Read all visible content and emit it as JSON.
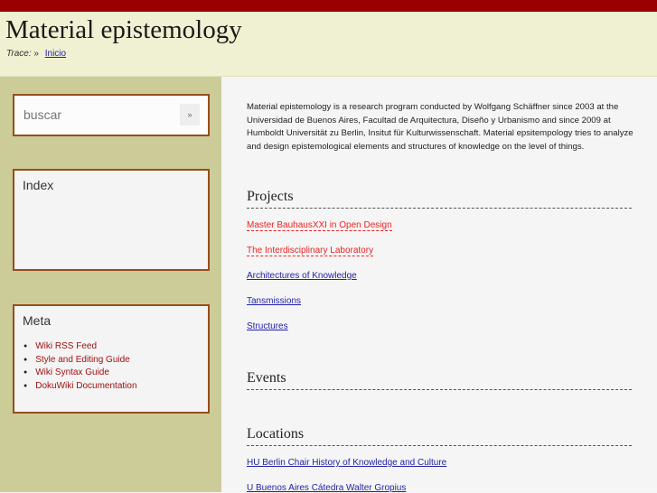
{
  "header": {
    "title": "Material epistemology",
    "trace_label": "Trace:",
    "trace_sep": "»",
    "breadcrumb": "Inicio"
  },
  "sidebar": {
    "search": {
      "placeholder": "buscar",
      "button": "»"
    },
    "index": {
      "title": "Index"
    },
    "meta": {
      "title": "Meta",
      "items": [
        "Wiki RSS Feed",
        "Style and Editing Guide",
        "Wiki Syntax Guide",
        "DokuWiki Documentation"
      ]
    }
  },
  "main": {
    "intro": "Material epistemology is a research program conducted by Wolfgang Schäffner since 2003 at the Universidad de Buenos Aires, Facultad de Arquitectura, Diseño y Urbanismo and since 2009 at Humboldt Universität zu Berlin, Insitut für Kulturwissenschaft. Material epsitempology tries to analyze and design epistemological elements and structures of knowledge on the level of things.",
    "projects": {
      "title": "Projects",
      "links": [
        "Master BauhausXXI in Open Design",
        "The Interdisciplinary Laboratory",
        "Architectures of Knowledge",
        "Tansmissions",
        "Structures"
      ]
    },
    "events": {
      "title": "Events"
    },
    "locations": {
      "title": "Locations",
      "links": [
        "HU Berlin Chair History of Knowledge and Culture",
        "U Buenos Aires Cátedra Walter Gropius"
      ]
    }
  },
  "colors": {
    "topbar": "#990000",
    "sidebar": "#cccc99",
    "box_border": "#9a4c1c",
    "missing_link": "#ee2222",
    "link": "#2222aa"
  }
}
